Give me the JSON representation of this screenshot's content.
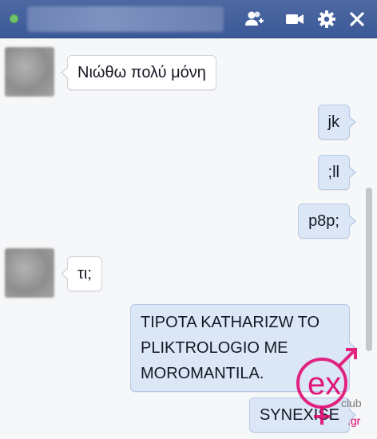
{
  "titlebar": {
    "online_status_color": "#6fc46b",
    "icons": [
      "add-friend-icon",
      "video-call-icon",
      "gear-icon",
      "close-icon"
    ]
  },
  "messages": [
    {
      "direction": "incoming",
      "text": "Νιώθω πολύ μόνη"
    },
    {
      "direction": "outgoing",
      "text": "jk"
    },
    {
      "direction": "outgoing",
      "text": ";ll"
    },
    {
      "direction": "outgoing",
      "text": "p8p;"
    },
    {
      "direction": "incoming",
      "text": "τι;"
    },
    {
      "direction": "outgoing",
      "lines": [
        "TIPOTA KATHARIZW TO",
        "PLIKTROLOGIO ME",
        "MOROMANTILA."
      ]
    },
    {
      "direction": "outgoing",
      "text": "SYNEXISE"
    }
  ],
  "watermark": {
    "brand_letters": "ex",
    "subtext": "club",
    "domain": ".gr",
    "color": "#e0006a"
  },
  "colors": {
    "header": "#3b5998",
    "incoming_bubble": "#ffffff",
    "outgoing_bubble": "#dbe6f7"
  }
}
